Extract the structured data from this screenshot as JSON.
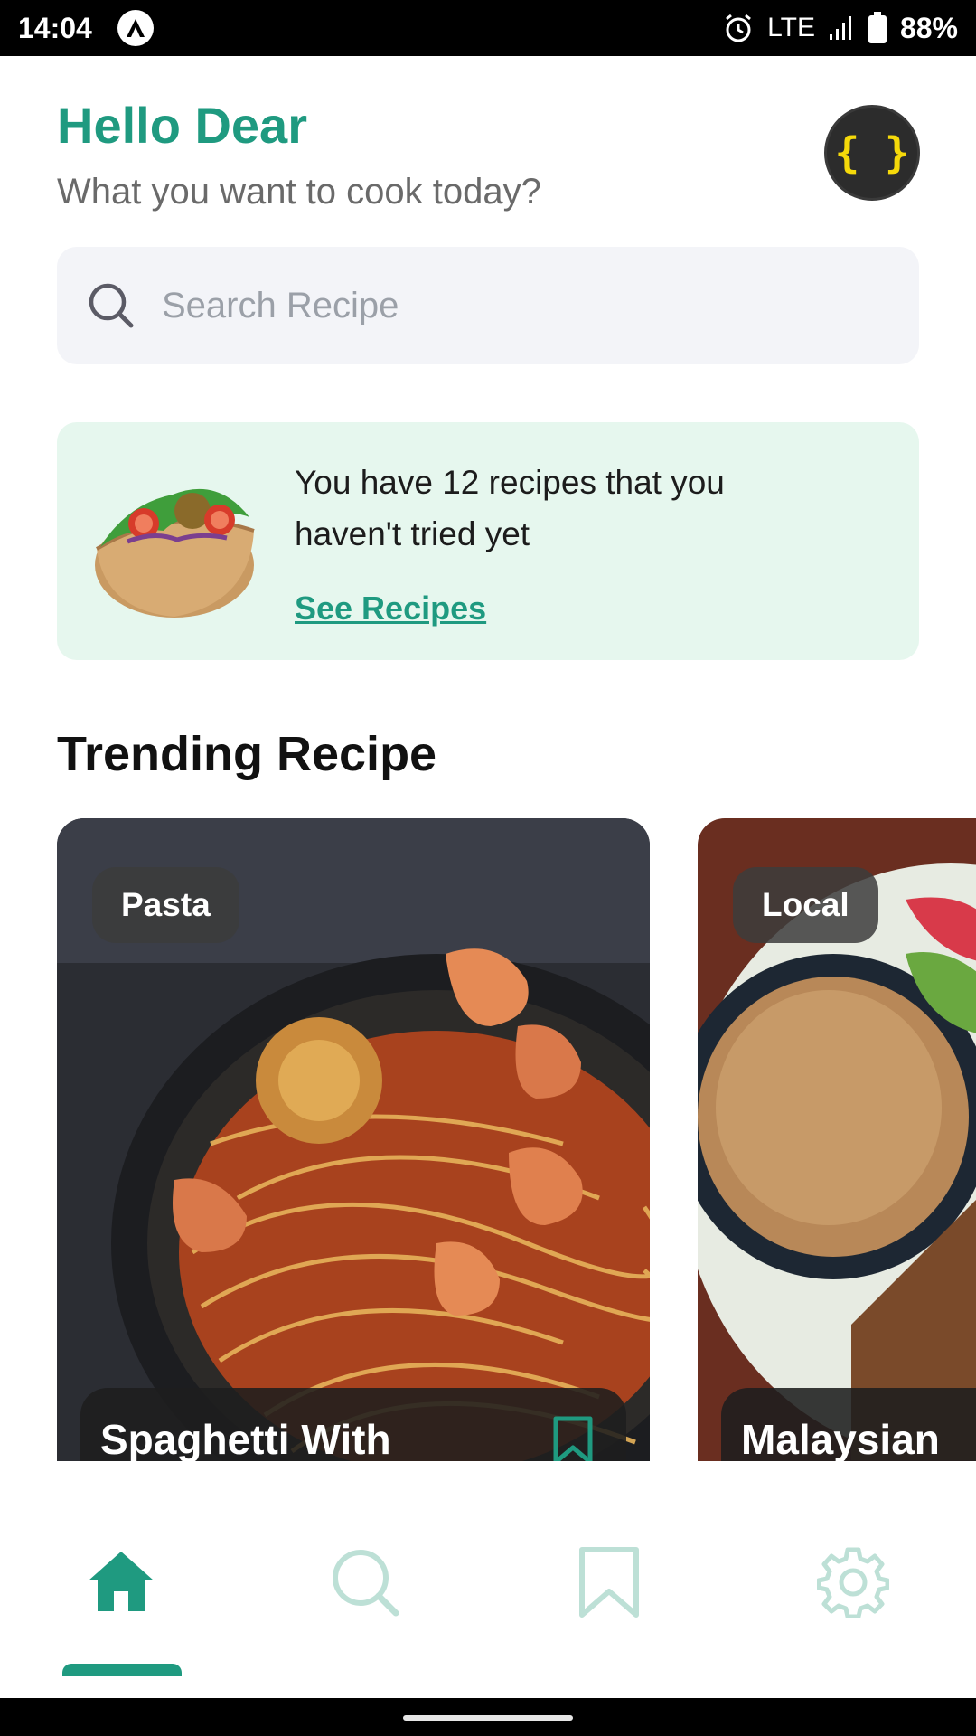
{
  "status_bar": {
    "time": "14:04",
    "network": "LTE",
    "battery": "88%"
  },
  "header": {
    "greeting": "Hello Dear",
    "subtitle": "What you want to cook today?",
    "avatar_text": "{ }"
  },
  "search": {
    "placeholder": "Search Recipe"
  },
  "promo": {
    "message": "You have 12 recipes that you haven't tried yet",
    "link_label": "See Recipes"
  },
  "trending": {
    "title": "Trending Recipe",
    "cards": [
      {
        "tag": "Pasta",
        "title": "Spaghetti With"
      },
      {
        "tag": "Local",
        "title": "Malaysian"
      }
    ]
  },
  "nav": {
    "items": [
      "home-icon",
      "search-icon",
      "bookmark-icon",
      "gear-icon"
    ],
    "active": "home"
  },
  "colors": {
    "accent": "#1f9a80",
    "promo_bg": "#e6f7ee",
    "search_bg": "#f3f4f8"
  }
}
